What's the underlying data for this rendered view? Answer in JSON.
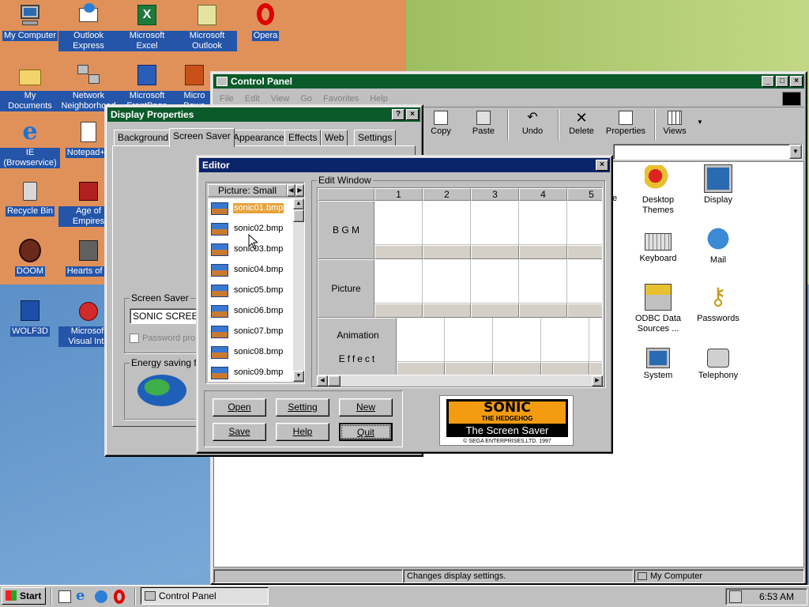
{
  "desktop": {
    "icons": [
      {
        "label": "My Computer"
      },
      {
        "label": "Outlook Express"
      },
      {
        "label": "Microsoft Excel"
      },
      {
        "label": "Microsoft Outlook"
      },
      {
        "label": "Opera"
      },
      {
        "label": "My Documents"
      },
      {
        "label": "Network Neighborhood"
      },
      {
        "label": "Microsoft FrontPage"
      },
      {
        "label": "Micro Powe"
      },
      {
        "label": "IE (Browservice)"
      },
      {
        "label": "Notepad++"
      },
      {
        "label": "Recycle Bin"
      },
      {
        "label": "Age of Empires"
      },
      {
        "label": "DOOM"
      },
      {
        "label": "Hearts of Ir"
      },
      {
        "label": "WOLF3D"
      },
      {
        "label": "Microsoft Visual Inte"
      }
    ]
  },
  "control_panel": {
    "title": "Control Panel",
    "menu": [
      "File",
      "Edit",
      "View",
      "Go",
      "Favorites",
      "Help"
    ],
    "toolbar": [
      "Copy",
      "Paste",
      "Undo",
      "Delete",
      "Properties",
      "Views"
    ],
    "items": [
      {
        "label": "Desktop Themes"
      },
      {
        "label": "Display"
      },
      {
        "label": "Keyboard"
      },
      {
        "label": "Mail"
      },
      {
        "label": "ODBC Data Sources ..."
      },
      {
        "label": "Passwords"
      },
      {
        "label": "System"
      },
      {
        "label": "Telephony"
      }
    ],
    "partial_label": "e",
    "status_left": "Changes display settings.",
    "status_right": "My Computer"
  },
  "display_properties": {
    "title": "Display Properties",
    "tabs": [
      "Background",
      "Screen Saver",
      "Appearance",
      "Effects",
      "Web",
      "Settings"
    ],
    "active_tab": "Screen Saver",
    "screen_saver_caption": "Screen Saver",
    "screen_saver_value": "SONIC SCREEN",
    "password_label": "Password pro",
    "energy_caption": "Energy saving fea"
  },
  "editor": {
    "title": "Editor",
    "picture_header": "Picture: Small",
    "files": [
      "sonic01.bmp",
      "sonic02.bmp",
      "sonic03.bmp",
      "sonic04.bmp",
      "sonic05.bmp",
      "sonic06.bmp",
      "sonic07.bmp",
      "sonic08.bmp",
      "sonic09.bmp"
    ],
    "selected_file": "sonic01.bmp",
    "edit_window_caption": "Edit Window",
    "columns": [
      "1",
      "2",
      "3",
      "4",
      "5"
    ],
    "rows": [
      "B G M",
      "Picture",
      "Animation",
      "Effect"
    ],
    "buttons": {
      "open": "Open",
      "setting": "Setting",
      "new": "New",
      "save": "Save",
      "help": "Help",
      "quit": "Quit"
    },
    "logo": {
      "line1": "SONIC",
      "line2": "THE HEDGEHOG",
      "line3": "The Screen Saver",
      "copyright": "© SEGA ENTERPRISES,LTD. 1997"
    }
  },
  "taskbar": {
    "start_label": "Start",
    "task_label": "Control Panel",
    "clock": "6:53 AM"
  },
  "colors": {
    "title_green": "#0b5a2a",
    "title_blue": "#0a246a",
    "selection": "#e7a33b",
    "sonic_orange": "#f39c12"
  }
}
